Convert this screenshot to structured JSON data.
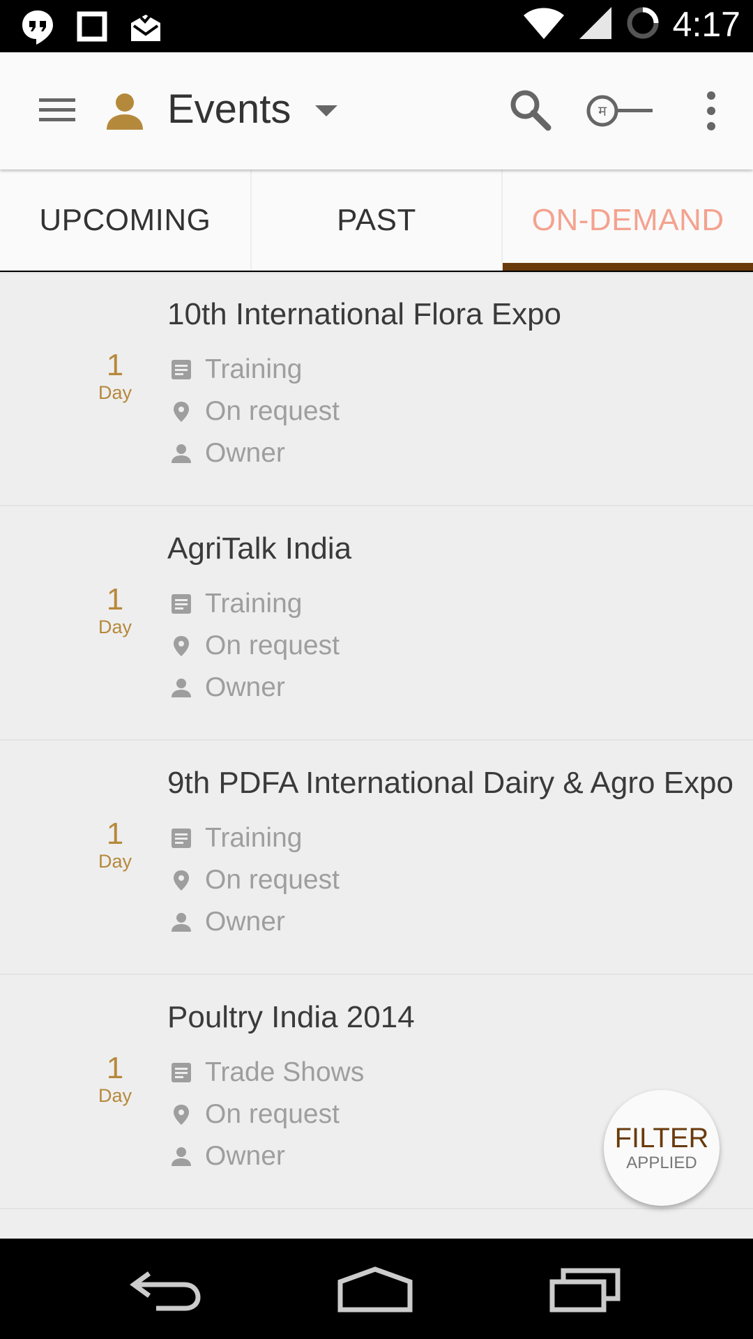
{
  "status_bar": {
    "time": "4:17",
    "icons": [
      "hangouts-icon",
      "square-notification-icon",
      "mail-icon",
      "wifi-icon",
      "signal-icon",
      "loading-icon"
    ]
  },
  "app_bar": {
    "title": "Events",
    "icons": [
      "menu-icon",
      "person-icon",
      "dropdown-icon",
      "search-icon",
      "language-toggle-icon",
      "more-vert-icon"
    ],
    "lang_glyph": "म"
  },
  "tabs": [
    {
      "label": "UPCOMING",
      "active": false
    },
    {
      "label": "PAST",
      "active": false
    },
    {
      "label": "ON-DEMAND",
      "active": true
    }
  ],
  "events": [
    {
      "name": "10th International Flora Expo",
      "duration": "1",
      "unit": "Day",
      "category": "Training",
      "location": "On request",
      "owner": "Owner"
    },
    {
      "name": "AgriTalk India",
      "duration": "1",
      "unit": "Day",
      "category": "Training",
      "location": "On request",
      "owner": "Owner"
    },
    {
      "name": "9th PDFA International Dairy & Agro Expo",
      "duration": "1",
      "unit": "Day",
      "category": "Training",
      "location": "On request",
      "owner": "Owner"
    },
    {
      "name": "Poultry India 2014",
      "duration": "1",
      "unit": "Day",
      "category": "Trade Shows",
      "location": "On request",
      "owner": "Owner"
    }
  ],
  "fab": {
    "main": "FILTER",
    "sub": "APPLIED"
  },
  "colors": {
    "accent": "#b5893c",
    "tab_active": "#f4a28f",
    "indicator": "#6a3a0c"
  }
}
